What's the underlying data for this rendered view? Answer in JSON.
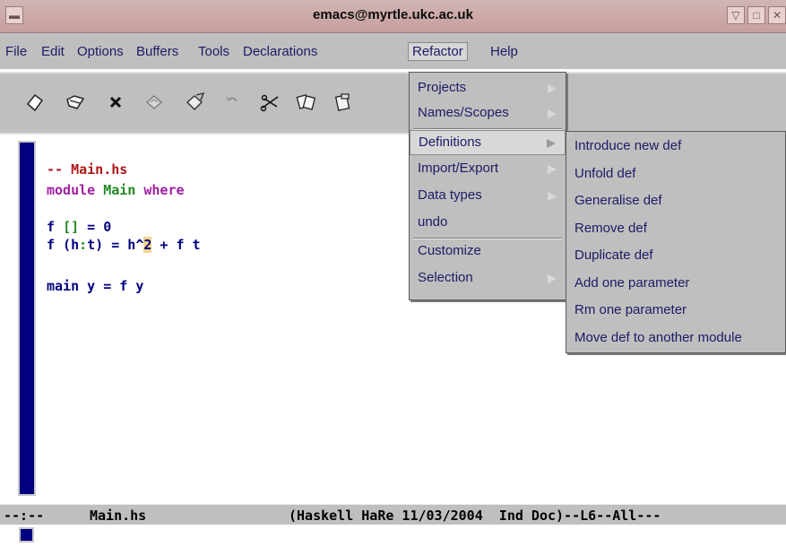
{
  "window": {
    "title": "emacs@myrtle.ukc.ac.uk",
    "controls": [
      "minimize",
      "maximize",
      "close"
    ]
  },
  "menubar": {
    "items": [
      "File",
      "Edit",
      "Options",
      "Buffers",
      "Tools",
      "Declarations",
      "Refactor",
      "Help"
    ],
    "open_item": "Refactor"
  },
  "toolbar": {
    "icons": [
      "open-file-icon",
      "open-folder-icon",
      "close-buffer-icon",
      "save-icon",
      "save-as-icon",
      "undo-icon",
      "cut-icon",
      "copy-icon",
      "paste-icon"
    ]
  },
  "editor": {
    "lines": [
      {
        "segments": [
          {
            "text": "-- Main.hs",
            "color": "#b01818"
          }
        ]
      },
      {
        "segments": [
          {
            "text": "module ",
            "color": "#a020a0"
          },
          {
            "text": "Main ",
            "color": "#228b22"
          },
          {
            "text": "where",
            "color": "#a020a0"
          }
        ]
      },
      {
        "segments": [
          {
            "text": "",
            "color": "#000080"
          }
        ]
      },
      {
        "segments": [
          {
            "text": "f ",
            "color": "#000080"
          },
          {
            "text": "[]",
            "color": "#228b22"
          },
          {
            "text": " = ",
            "color": "#000080"
          },
          {
            "text": "0",
            "color": "#000080"
          }
        ]
      },
      {
        "segments": [
          {
            "text": "f (h",
            "color": "#000080"
          },
          {
            "text": ":",
            "color": "#228b22"
          },
          {
            "text": "t) = h^",
            "color": "#000080"
          },
          {
            "text": "2",
            "color": "#000080",
            "highlight": "#f5d58a"
          },
          {
            "text": " + f t",
            "color": "#000080"
          }
        ]
      },
      {
        "segments": [
          {
            "text": "",
            "color": "#000080"
          }
        ]
      },
      {
        "segments": [
          {
            "text": "main y = f y",
            "color": "#000080"
          }
        ]
      }
    ]
  },
  "modeline": {
    "prefix": "--:--",
    "buffer": "Main.hs",
    "modes": "(Haskell HaRe 11/03/2004  Ind Doc)--L6--All---"
  },
  "refactor_menu": {
    "items": [
      {
        "label": "Projects",
        "submenu": true
      },
      {
        "label": "Names/Scopes",
        "submenu": true
      },
      {
        "label": "Definitions",
        "submenu": true,
        "highlighted": true
      },
      {
        "label": "Import/Export",
        "submenu": true
      },
      {
        "label": "Data types",
        "submenu": true
      },
      {
        "label": "undo",
        "submenu": false
      },
      {
        "label": "Customize",
        "submenu": false
      },
      {
        "label": "Selection",
        "submenu": true
      }
    ]
  },
  "definitions_submenu": {
    "items": [
      "Introduce new def",
      "Unfold def",
      "Generalise def",
      "Remove def",
      "Duplicate def",
      "Add one parameter",
      "Rm one parameter",
      "Move def to another module"
    ]
  }
}
